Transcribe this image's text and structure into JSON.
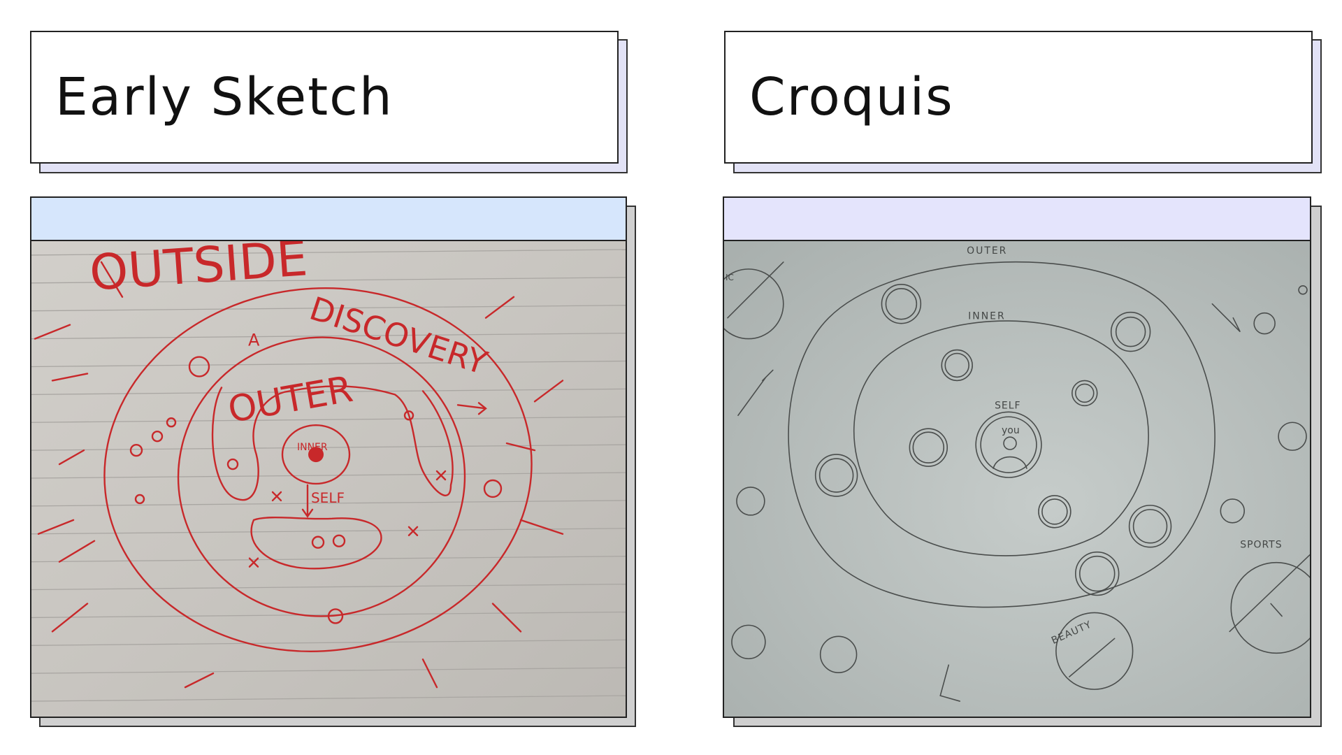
{
  "panels": {
    "left": {
      "title": "Early Sketch",
      "title_shadow_color": "#e2e2f6",
      "bar_color": "#d6e6fc",
      "card_shadow_color": "#d0d0d0",
      "sketch_labels": {
        "outside": "OUTSIDE",
        "discovery": "DISCOVERY",
        "outer": "OUTER",
        "inner": "INNER",
        "self": "SELF",
        "a": "A"
      }
    },
    "right": {
      "title": "Croquis",
      "title_shadow_color": "#e2e2f6",
      "bar_color": "#e4e4fc",
      "card_shadow_color": "#cfcfcf",
      "sketch_labels": {
        "outer": "OUTER",
        "inner": "INNER",
        "self": "SELF",
        "you": "you",
        "sports": "SPORTS",
        "beauty": "BEAUTY",
        "ic": "IC"
      }
    }
  }
}
